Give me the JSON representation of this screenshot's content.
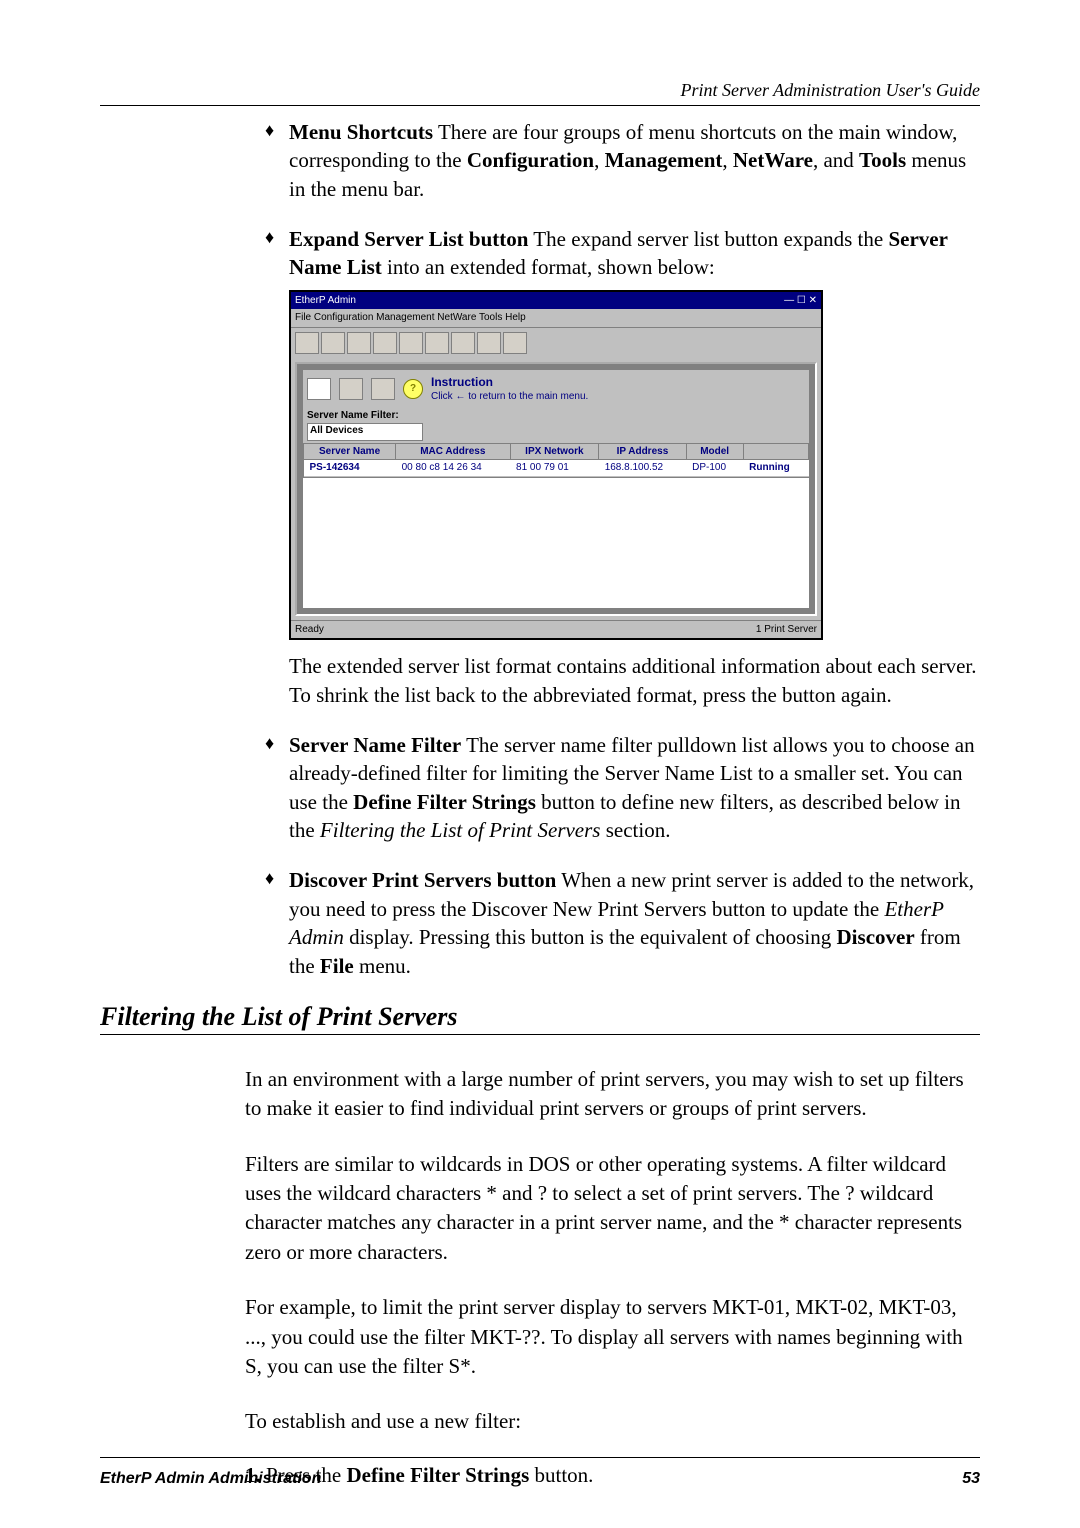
{
  "header": {
    "title": "Print Server Administration User's Guide"
  },
  "bullets": {
    "b1_term": "Menu Shortcuts",
    "b1_rest": "  There are four groups of menu shortcuts on the main window, corresponding to the ",
    "b1_cfg": "Configuration",
    "b1_c1": ", ",
    "b1_mgmt": "Management",
    "b1_c2": ", ",
    "b1_nw": "NetWare",
    "b1_c3": ", and ",
    "b1_tools": "Tools",
    "b1_end": " menus in the menu bar.",
    "b2_term": "Expand Server List button",
    "b2_rest": "  The expand server list button expands the ",
    "b2_snl": "Server Name List",
    "b2_end": " into an extended format, shown below:",
    "b2_after": "The extended server list format contains additional information about each server.  To shrink the list back to the abbreviated format, press the button again.",
    "b3_term": "Server Name Filter",
    "b3_rest": "  The server name filter pulldown list allows you to choose an already-defined filter for limiting the Server Name List to a smaller set.  You can use the ",
    "b3_dfs": "Define Filter Strings",
    "b3_mid": " button to define new filters, as described below in the ",
    "b3_it": "Filtering the List of Print Servers",
    "b3_end": " section.",
    "b4_term": "Discover Print Servers button",
    "b4_rest": "  When a new print server is added to the network, you need to press the Discover New Print Servers button to update the ",
    "b4_it": "EtherP Admin",
    "b4_mid": " display.  Pressing this button is the equivalent of choosing ",
    "b4_disc": "Discover",
    "b4_from": " from the ",
    "b4_file": "File",
    "b4_end": " menu."
  },
  "section": {
    "title": "Filtering the List of Print Servers"
  },
  "body": {
    "p1": "In an environment with a large number of print servers, you may wish to set up filters to make it easier to find individual print servers or groups of print servers.",
    "p2": "Filters are similar to wildcards in DOS or other operating systems.  A filter wildcard uses the wildcard characters * and ? to select a set of print servers.  The ? wildcard character matches any character in a print server name, and the * character represents zero or more characters.",
    "p3": "For example, to limit the print server display to servers MKT-01, MKT-02, MKT-03, ..., you could use the filter MKT-??.  To display all servers with names beginning with S, you can use the filter S*.",
    "p4": "To establish and use a new filter:"
  },
  "step": {
    "num": "1.",
    "pre": "  Press the ",
    "dfs": "Define Filter Strings",
    "post": " button."
  },
  "footer": {
    "left": "EtherP Admin Administration",
    "right": "53"
  },
  "ss": {
    "title": "EtherP Admin",
    "menu": "File   Configuration   Management   NetWare   Tools   Help",
    "instr": "Instruction",
    "instr_sub": "Click ← to return to the main menu.",
    "filter_label": "Server Name Filter:",
    "filter_val": "All Devices",
    "cols": [
      "Server Name",
      "MAC Address",
      "IPX Network",
      "IP Address",
      "Model",
      ""
    ],
    "row": [
      "PS-142634",
      "00 80 c8 14 26 34",
      "81 00 79 01",
      "168.8.100.52",
      "DP-100",
      "Running"
    ],
    "status_left": "Ready",
    "status_right": "1 Print Server"
  }
}
